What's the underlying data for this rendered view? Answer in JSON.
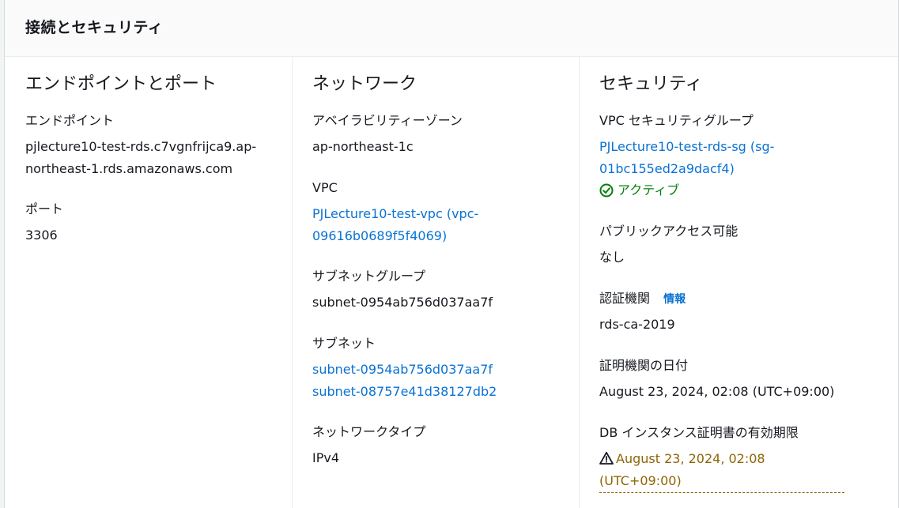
{
  "panel": {
    "title": "接続とセキュリティ"
  },
  "endpoint_port": {
    "heading": "エンドポイントとポート",
    "endpoint_label": "エンドポイント",
    "endpoint_value": "pjlecture10-test-rds.c7vgnfrijca9.ap-northeast-1.rds.amazonaws.com",
    "port_label": "ポート",
    "port_value": "3306"
  },
  "network": {
    "heading": "ネットワーク",
    "az_label": "アベイラビリティーゾーン",
    "az_value": "ap-northeast-1c",
    "vpc_label": "VPC",
    "vpc_value": "PJLecture10-test-vpc (vpc-09616b0689f5f4069)",
    "subnet_group_label": "サブネットグループ",
    "subnet_group_value": "subnet-0954ab756d037aa7f",
    "subnets_label": "サブネット",
    "subnets": [
      "subnet-0954ab756d037aa7f",
      "subnet-08757e41d38127db2"
    ],
    "network_type_label": "ネットワークタイプ",
    "network_type_value": "IPv4"
  },
  "security": {
    "heading": "セキュリティ",
    "sg_label": "VPC セキュリティグループ",
    "sg_value": "PJLecture10-test-rds-sg (sg-01bc155ed2a9dacf4)",
    "sg_status": "アクティブ",
    "public_access_label": "パブリックアクセス可能",
    "public_access_value": "なし",
    "ca_label": "認証機関",
    "ca_info": "情報",
    "ca_value": "rds-ca-2019",
    "ca_date_label": "証明機関の日付",
    "ca_date_value": "August 23, 2024, 02:08 (UTC+09:00)",
    "cert_expiry_label": "DB インスタンス証明書の有効期限",
    "cert_expiry_value": "August 23, 2024, 02:08 (UTC+09:00)"
  },
  "colors": {
    "link": "#0972d3",
    "success": "#037f0c",
    "warning": "#8d6605"
  },
  "icons": {
    "status_ok": "status-positive-icon",
    "warning": "warning-icon"
  }
}
